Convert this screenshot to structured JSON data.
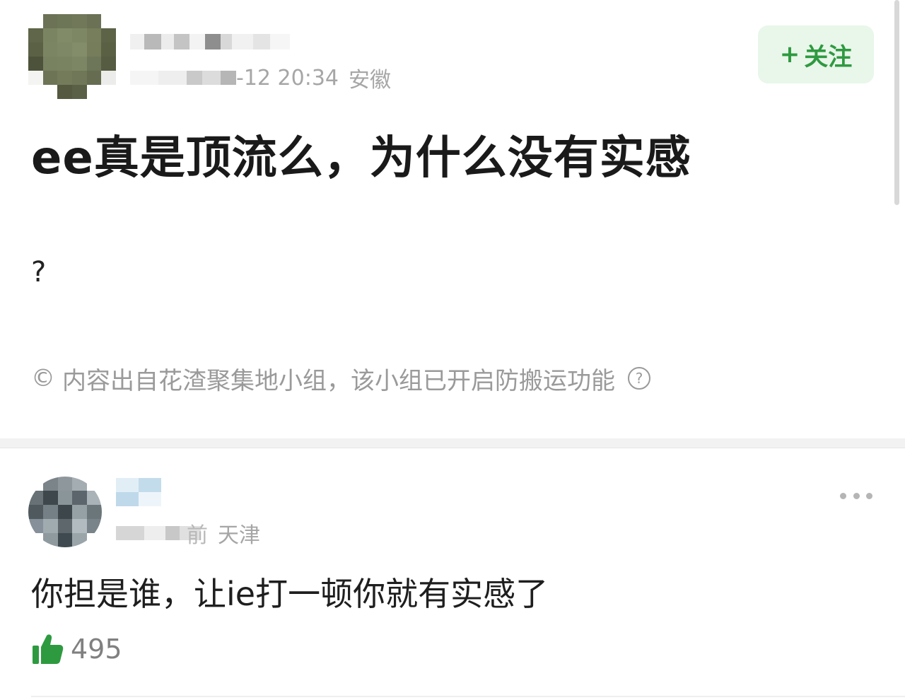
{
  "post": {
    "meta_time": "-12 20:34",
    "meta_location": "安徽",
    "follow_label": "关注",
    "follow_plus": "+",
    "title": "ee真是顶流么，为什么没有实感",
    "body": "?",
    "notice_symbol": "©",
    "notice_text": "内容出自花渣聚集地小组，该小组已开启防搬运功能",
    "notice_help": "?"
  },
  "comment": {
    "meta_time": "前",
    "meta_location": "天津",
    "text": "你担是谁，让ie打一顿你就有实感了",
    "likes": "495"
  },
  "colors": {
    "accent": "#2e9a40",
    "follow_bg": "#e9f6ea",
    "like_icon": "#2e9a40",
    "meta_text": "#a6a6a6"
  },
  "icons": {
    "like": "thumbs-up-icon",
    "more": "more-dots-icon",
    "help": "question-circle-icon"
  }
}
